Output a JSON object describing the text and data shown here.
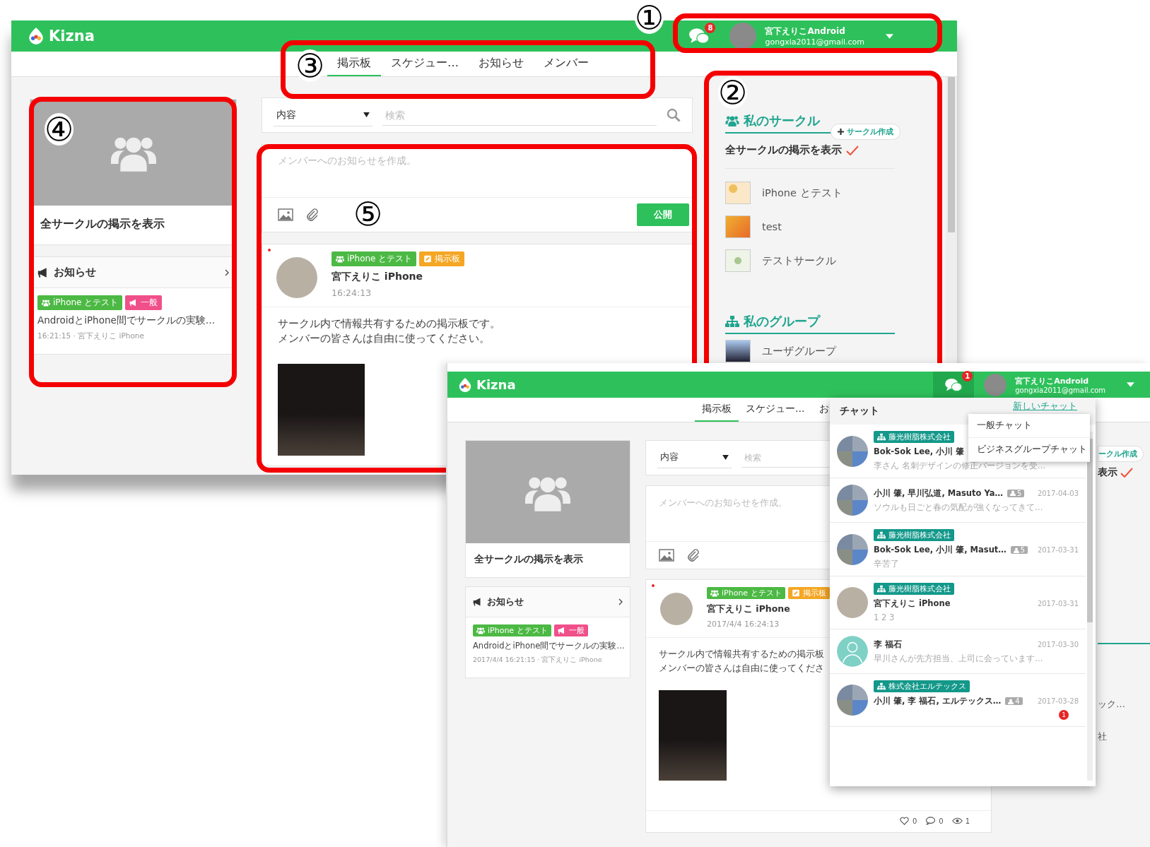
{
  "annotations": [
    {
      "number": "①"
    },
    {
      "number": "②"
    },
    {
      "number": "③"
    },
    {
      "number": "④"
    },
    {
      "number": "⑤"
    }
  ],
  "main_window": {
    "logo": "Kizna",
    "header": {
      "chat_open": false,
      "chat_badge": "8",
      "user_name": "宮下えりこAndroid",
      "user_email": "gongxia2011@gmail.com"
    },
    "tabs": [
      {
        "label": "掲示板",
        "selected": true
      },
      {
        "label": "スケジュー…",
        "selected": false
      },
      {
        "label": "お知らせ",
        "selected": false
      },
      {
        "label": "メンバー",
        "selected": false
      }
    ],
    "circle_card": {
      "title": "全サークルの掲示を表示"
    },
    "notices": {
      "title": "お知らせ",
      "items": [
        {
          "tags": [
            {
              "label": "iPhone とテスト",
              "kind": "circle"
            },
            {
              "label": "一般",
              "kind": "notice"
            }
          ],
          "text": "AndroidとiPhone間でサークルの実験…",
          "meta": "16:21:15 · 宮下えりこ iPhone"
        }
      ]
    },
    "search": {
      "filter": "内容",
      "placeholder": "検索"
    },
    "composer": {
      "placeholder": "メンバーへのお知らせを作成。",
      "publish": "公開"
    },
    "posts": [
      {
        "unread": true,
        "tags": [
          {
            "label": "iPhone とテスト",
            "kind": "circle"
          },
          {
            "label": "掲示板",
            "kind": "board"
          }
        ],
        "author": "宮下えりこ iPhone",
        "time": "16:24:13",
        "body": [
          "サークル内で情報共有するための掲示板です。",
          "メンバーの皆さんは自由に使ってください。"
        ]
      }
    ],
    "sidebar": {
      "circles_title": "私のサークル",
      "create_circle": "サークル作成",
      "show_all": {
        "label": "全サークルの掲示を表示",
        "checked": true
      },
      "circles": [
        {
          "name": "iPhone とテスト"
        },
        {
          "name": "test"
        },
        {
          "name": "テストサークル"
        }
      ],
      "groups_title": "私のグループ",
      "groups": [
        {
          "name": "ユーザグループ"
        }
      ]
    }
  },
  "chat_window": {
    "logo": "Kizna",
    "header": {
      "chat_open": true,
      "chat_badge": "1",
      "user_name": "宮下えりこAndroid",
      "user_email": "gongxia2011@gmail.com"
    },
    "tabs": [
      {
        "label": "掲示板",
        "selected": true
      },
      {
        "label": "スケジュー…",
        "selected": false
      },
      {
        "label": "お",
        "selected": false
      }
    ],
    "circle_card": {
      "title": "全サークルの掲示を表示"
    },
    "notices": {
      "title": "お知らせ",
      "items": [
        {
          "tags": [
            {
              "label": "iPhone とテスト",
              "kind": "circle"
            },
            {
              "label": "一般",
              "kind": "notice"
            }
          ],
          "text": "AndroidとiPhone間でサークルの実験…",
          "meta": "2017/4/4 16:21:15 · 宮下えりこ iPhone"
        }
      ]
    },
    "search": {
      "filter": "内容",
      "placeholder": "検索"
    },
    "composer": {
      "placeholder": "メンバーへのお知らせを作成。"
    },
    "posts": [
      {
        "unread": true,
        "tags": [
          {
            "label": "iPhone とテスト",
            "kind": "circle"
          },
          {
            "label": "掲示板",
            "kind": "board"
          }
        ],
        "author": "宮下えりこ iPhone",
        "time": "2017/4/4 16:24:13",
        "body": [
          "サークル内で情報共有するための掲示板",
          "メンバーの皆さんは自由に使ってくださ"
        ],
        "stats": {
          "likes": "0",
          "comments": "0",
          "views": "1"
        }
      }
    ],
    "sidebar_fragments": [
      {
        "kind": "pill",
        "text": "ークル作成"
      },
      {
        "kind": "checked",
        "text": "表示"
      },
      {
        "kind": "rule"
      },
      {
        "kind": "text",
        "text": "ック…"
      },
      {
        "kind": "text",
        "text": "社"
      }
    ],
    "chat": {
      "title": "チャット",
      "new_chat": "新しいチャット",
      "menu": [
        {
          "label": "一般チャット"
        },
        {
          "label": "ビジネスグループチャット"
        }
      ],
      "items": [
        {
          "kind": "collage",
          "group": "藤光樹脂株式会社",
          "name": "Bok-Sok Lee, 小川 肇",
          "preview": "李さん 名刺デザインの修正バージョンを受…"
        },
        {
          "kind": "collage",
          "name": "小川 肇, 早川弘道, Masuto Ya…",
          "count": "5",
          "date": "2017-04-03",
          "preview": "ソウルも日ごと春の気配が強くなってきて…"
        },
        {
          "kind": "collage",
          "group": "藤光樹脂株式会社",
          "name": "Bok-Sok Lee, 小川 肇, Masut…",
          "count": "5",
          "date": "2017-03-31",
          "preview": "辛苦了"
        },
        {
          "kind": "photo",
          "group": "藤光樹脂株式会社",
          "name": "宮下えりこ iPhone",
          "date": "2017-03-31",
          "preview": "1 2 3"
        },
        {
          "kind": "silhouette",
          "name": "李 福石",
          "date": "2017-03-30",
          "preview": "早川さんが先方担当、上司に会っています…"
        },
        {
          "kind": "collage",
          "group": "株式会社エルテックス",
          "name": "小川 肇, 李 福石, エルテックス…",
          "count": "4",
          "date": "2017-03-28",
          "unread": "1"
        }
      ]
    }
  }
}
